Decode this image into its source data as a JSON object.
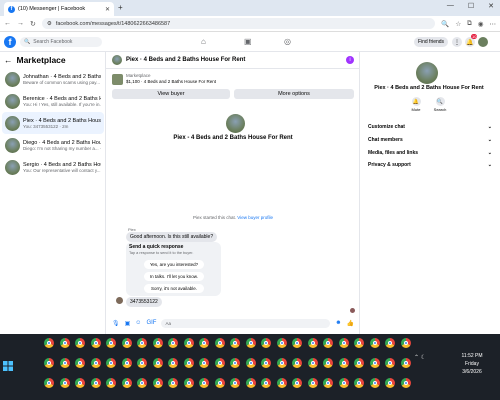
{
  "browser": {
    "tab_title": "(10) Messenger | Facebook",
    "url": "facebook.com/messages/t/1480622663486587"
  },
  "fb": {
    "search_placeholder": "Search Facebook",
    "find_friends": "Find friends",
    "notification_count": "10"
  },
  "left": {
    "title": "Marketplace",
    "conversations": [
      {
        "name": "Johnathan · 4 Beds and 2 Baths H...",
        "preview": "Beware of common scams using pay... · 1m"
      },
      {
        "name": "Berenice · 4 Beds and 2 Baths Ho...",
        "preview": "You: Hi ! Yes, still available. If you're in... · 1m"
      },
      {
        "name": "Piex · 4 Beds and 2 Baths House F...",
        "preview": "You: 3473553122 · 2m"
      },
      {
        "name": "Diego · 4 Beds and 2 Baths House ...",
        "preview": "Diego: I'm not Sharing my number a... · 21h"
      },
      {
        "name": "Sergio · 4 Beds and 2 Baths Hous...",
        "preview": "You: Our representative will contact y... · 2d"
      }
    ]
  },
  "center": {
    "title": "Piex · 4 Beds and 2 Baths House For Rent",
    "listing_label": "Marketplace",
    "listing_text": "$1,100 · 4 Beds and 2 Baths House For Rent",
    "view_buyer": "View buyer",
    "more_options": "More options",
    "header_name": "Piex - 4 Beds and 2 Baths House For Rent",
    "started_text": "Piex started this chat.",
    "started_link": "View buyer profile",
    "sender": "Piex",
    "incoming": "Good afternoon. Is this still available?",
    "quick_title": "Send a quick response",
    "quick_sub": "Tap a response to send it to the buyer.",
    "quick_replies": [
      "Yes, are you interested?",
      "In talks. I'll let you know.",
      "Sorry, it's not available."
    ],
    "outgoing": "3473553122",
    "composer_placeholder": "Aa"
  },
  "right": {
    "name": "Piex · 4 Beds and 2 Baths House For Rent",
    "actions": [
      "Mute",
      "Search"
    ],
    "sections": [
      "Customize chat",
      "Chat members",
      "Media, files and links",
      "Privacy & support"
    ]
  },
  "taskbar": {
    "time": "11:52 PM",
    "day": "Friday",
    "date": "3/6/2026"
  },
  "colors": {
    "accent": "#1877f2",
    "taskbar": "#1c2128"
  }
}
